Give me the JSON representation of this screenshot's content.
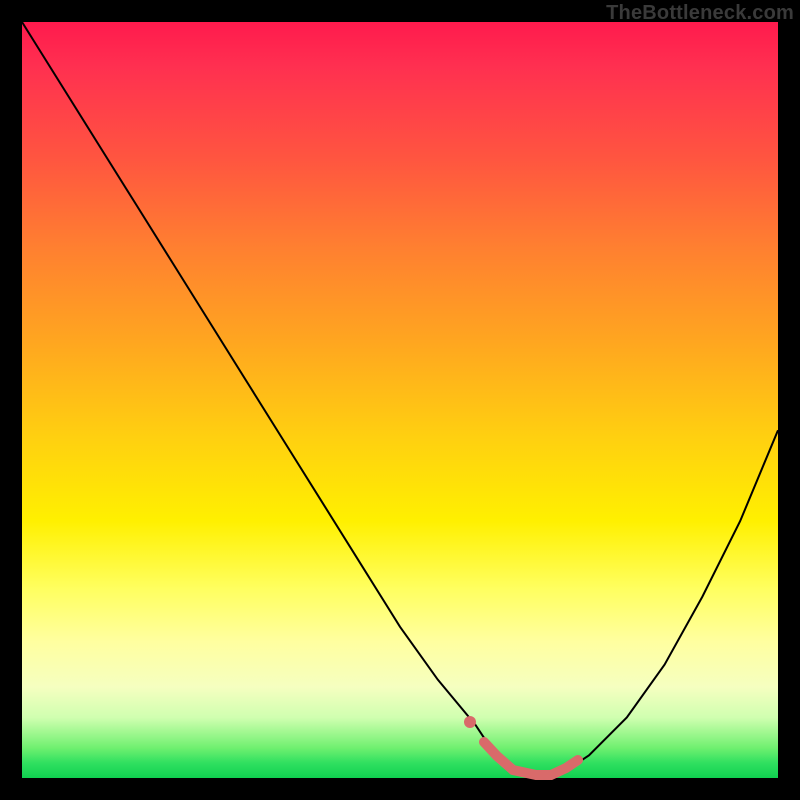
{
  "watermark": "TheBottleneck.com",
  "colors": {
    "background": "#000000",
    "curve": "#000000",
    "highlight": "#d96a6a",
    "gradient_top": "#ff1a4d",
    "gradient_bottom": "#10d050"
  },
  "chart_data": {
    "type": "line",
    "title": "",
    "xlabel": "",
    "ylabel": "",
    "xlim": [
      0,
      100
    ],
    "ylim": [
      0,
      100
    ],
    "x": [
      0,
      5,
      10,
      15,
      20,
      25,
      30,
      35,
      40,
      45,
      50,
      55,
      60,
      62,
      65,
      68,
      70,
      72,
      75,
      80,
      85,
      90,
      95,
      100
    ],
    "values": [
      100,
      92,
      84,
      76,
      68,
      60,
      52,
      44,
      36,
      28,
      20,
      13,
      7,
      4,
      1,
      0,
      0,
      1,
      3,
      8,
      15,
      24,
      34,
      46
    ],
    "highlight_range_x": [
      58,
      73
    ],
    "annotations": []
  }
}
